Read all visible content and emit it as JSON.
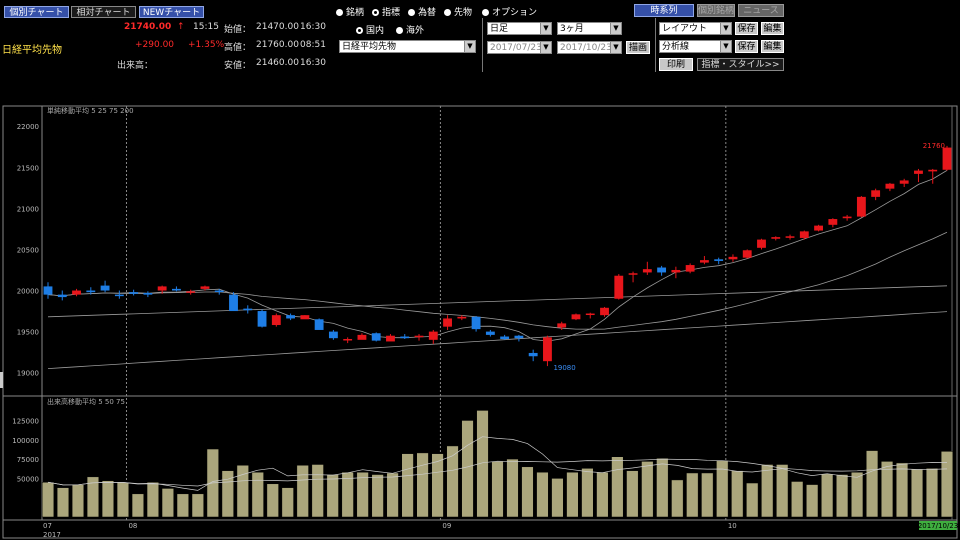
{
  "colors": {
    "up": "#e8161b",
    "down": "#1e7ee6",
    "volume": "#aba67c",
    "price_up": "#ff2a2a",
    "ma": "#9a9a9a"
  },
  "tabs": [
    "個別チャート",
    "相対チャート",
    "NEWチャート"
  ],
  "quote": {
    "name": "日経平均先物",
    "last": "21740.00",
    "arrow": "↑",
    "time": "15:15",
    "change": "+290.00",
    "change_pct": "+1.35%",
    "volume_label": "出来高：",
    "open_label": "始値：",
    "open_value": "21470.00",
    "open_time": "16:30",
    "high_label": "高値：",
    "high_value": "21760.00",
    "high_time": "08:51",
    "low_label": "安値：",
    "low_value": "21460.00",
    "low_time": "16:30"
  },
  "instrument_radios": [
    {
      "label": "銘柄",
      "selected": false
    },
    {
      "label": "指標",
      "selected": true
    },
    {
      "label": "為替",
      "selected": false
    },
    {
      "label": "先物",
      "selected": false
    },
    {
      "label": "オプション",
      "selected": false
    }
  ],
  "market_radios": [
    {
      "label": "国内",
      "selected": true
    },
    {
      "label": "海外",
      "selected": false
    }
  ],
  "instrument_select": "日経平均先物",
  "period": {
    "bar_type": "日足",
    "range": "3ヶ月",
    "from": "2017/07/23",
    "to": "2017/10/23",
    "draw_label": "描画"
  },
  "toolbar": {
    "timeseries": "時系列",
    "individual": "個別銘柄",
    "news": "ニュース",
    "layout": "レイアウト",
    "analysis": "分析線",
    "save": "保存",
    "edit": "編集",
    "print": "印刷",
    "indicators": "指標・スタイル>>"
  },
  "chart_data": [
    {
      "type": "candlestick",
      "title": "単純移動平均 5 25 75 200",
      "yticks": [
        19000,
        19500,
        20000,
        20500,
        21000,
        21500,
        22000
      ],
      "ylim": [
        18850,
        22100
      ],
      "annotations": {
        "high": "21760",
        "low": "19080"
      },
      "x_labels": [
        {
          "index": 0,
          "label": "07"
        },
        {
          "index": 6,
          "label": "08"
        },
        {
          "index": 28,
          "label": "09"
        },
        {
          "index": 48,
          "label": "10"
        }
      ],
      "x_year": "2017",
      "x_last_date": "2017/10/23",
      "candles": [
        [
          20050,
          20100,
          19900,
          19950
        ],
        [
          19950,
          20000,
          19880,
          19920
        ],
        [
          19950,
          20020,
          19930,
          20000
        ],
        [
          20000,
          20040,
          19950,
          19980
        ],
        [
          20060,
          20120,
          19980,
          20000
        ],
        [
          19950,
          20000,
          19900,
          19940
        ],
        [
          19980,
          20010,
          19940,
          19960
        ],
        [
          19970,
          19990,
          19920,
          19950
        ],
        [
          20000,
          20060,
          19960,
          20050
        ],
        [
          20020,
          20050,
          19990,
          20000
        ],
        [
          19980,
          20010,
          19950,
          19990
        ],
        [
          20020,
          20060,
          20000,
          20050
        ],
        [
          20000,
          20020,
          19950,
          19990
        ],
        [
          19950,
          19980,
          19800,
          19750
        ],
        [
          19780,
          19820,
          19720,
          19760
        ],
        [
          19750,
          19770,
          19550,
          19560
        ],
        [
          19580,
          19720,
          19560,
          19700
        ],
        [
          19700,
          19720,
          19640,
          19660
        ],
        [
          19650,
          19680,
          19700,
          19700
        ],
        [
          19650,
          19660,
          19530,
          19520
        ],
        [
          19500,
          19520,
          19400,
          19420
        ],
        [
          19400,
          19430,
          19360,
          19410
        ],
        [
          19400,
          19480,
          19440,
          19460
        ],
        [
          19480,
          19490,
          19380,
          19390
        ],
        [
          19380,
          19470,
          19390,
          19450
        ],
        [
          19440,
          19470,
          19410,
          19420
        ],
        [
          19450,
          19470,
          19390,
          19450
        ],
        [
          19400,
          19520,
          19350,
          19500
        ],
        [
          19560,
          19700,
          19520,
          19660
        ],
        [
          19660,
          19700,
          19640,
          19680
        ],
        [
          19680,
          19690,
          19500,
          19530
        ],
        [
          19500,
          19520,
          19440,
          19460
        ],
        [
          19440,
          19460,
          19400,
          19410
        ],
        [
          19450,
          19460,
          19380,
          19420
        ],
        [
          19240,
          19280,
          19140,
          19200
        ],
        [
          19140,
          19450,
          19080,
          19430
        ],
        [
          19550,
          19620,
          19520,
          19600
        ],
        [
          19650,
          19720,
          19640,
          19710
        ],
        [
          19710,
          19730,
          19660,
          19720
        ],
        [
          19700,
          19800,
          19680,
          19790
        ],
        [
          19900,
          20200,
          19890,
          20180
        ],
        [
          20200,
          20230,
          20100,
          20210
        ],
        [
          20220,
          20350,
          20190,
          20260
        ],
        [
          20280,
          20300,
          20180,
          20220
        ],
        [
          20220,
          20290,
          20150,
          20250
        ],
        [
          20230,
          20330,
          20210,
          20310
        ],
        [
          20340,
          20420,
          20320,
          20370
        ],
        [
          20380,
          20400,
          20320,
          20360
        ],
        [
          20380,
          20440,
          20350,
          20410
        ],
        [
          20400,
          20500,
          20390,
          20490
        ],
        [
          20520,
          20630,
          20500,
          20620
        ],
        [
          20630,
          20660,
          20610,
          20650
        ],
        [
          20650,
          20680,
          20620,
          20660
        ],
        [
          20640,
          20730,
          20620,
          20720
        ],
        [
          20730,
          20800,
          20720,
          20790
        ],
        [
          20800,
          20880,
          20770,
          20870
        ],
        [
          20880,
          20920,
          20850,
          20900
        ],
        [
          20900,
          21150,
          20890,
          21140
        ],
        [
          21140,
          21240,
          21100,
          21220
        ],
        [
          21240,
          21310,
          21210,
          21300
        ],
        [
          21300,
          21360,
          21260,
          21340
        ],
        [
          21420,
          21480,
          21320,
          21460
        ],
        [
          21450,
          21480,
          21300,
          21470
        ],
        [
          21470,
          21760,
          21460,
          21740
        ]
      ]
    },
    {
      "type": "bar",
      "title": "出来高移動平均 5 50 75",
      "yticks": [
        50000,
        75000,
        100000,
        125000
      ],
      "ylim": [
        0,
        145000
      ],
      "values": [
        45000,
        38000,
        42000,
        52000,
        47000,
        45000,
        30000,
        45000,
        37000,
        30000,
        30000,
        88000,
        60000,
        67000,
        58000,
        43000,
        38000,
        67000,
        68000,
        55000,
        58000,
        58000,
        55000,
        57000,
        82000,
        83000,
        82000,
        92000,
        125000,
        138000,
        72000,
        75000,
        65000,
        58000,
        50000,
        58000,
        63000,
        58000,
        78000,
        60000,
        72000,
        76000,
        48000,
        57000,
        57000,
        73000,
        60000,
        44000,
        68000,
        68000,
        46000,
        42000,
        56000,
        55000,
        58000,
        86000,
        72000,
        70000,
        62000,
        63000,
        85000
      ]
    }
  ]
}
